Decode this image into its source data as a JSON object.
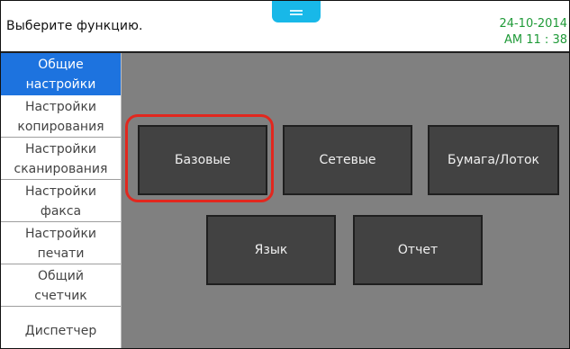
{
  "header": {
    "prompt": "Выберите функцию.",
    "date": "24-10-2014",
    "time": "AM 11 : 38"
  },
  "sidebar": {
    "items": [
      {
        "lines": [
          "Общие",
          "настройки"
        ]
      },
      {
        "lines": [
          "Настройки",
          "копирования"
        ]
      },
      {
        "lines": [
          "Настройки",
          "сканирования"
        ]
      },
      {
        "lines": [
          "Настройки",
          "факса"
        ]
      },
      {
        "lines": [
          "Настройки",
          "печати"
        ]
      },
      {
        "lines": [
          "Общий",
          "счетчик"
        ]
      },
      {
        "lines": [
          "Диспетчер"
        ]
      }
    ]
  },
  "main": {
    "buttons": [
      {
        "label": "Базовые"
      },
      {
        "label": "Сетевые"
      },
      {
        "label": "Бумага/Лоток"
      },
      {
        "label": "Язык"
      },
      {
        "label": "Отчет"
      }
    ]
  },
  "colors": {
    "selected_bg": "#1d73df",
    "content_bg": "#808080",
    "button_bg": "#424242",
    "highlight": "#e2271e",
    "datetime_text": "#1f9a38",
    "notch": "#18b8e8"
  }
}
